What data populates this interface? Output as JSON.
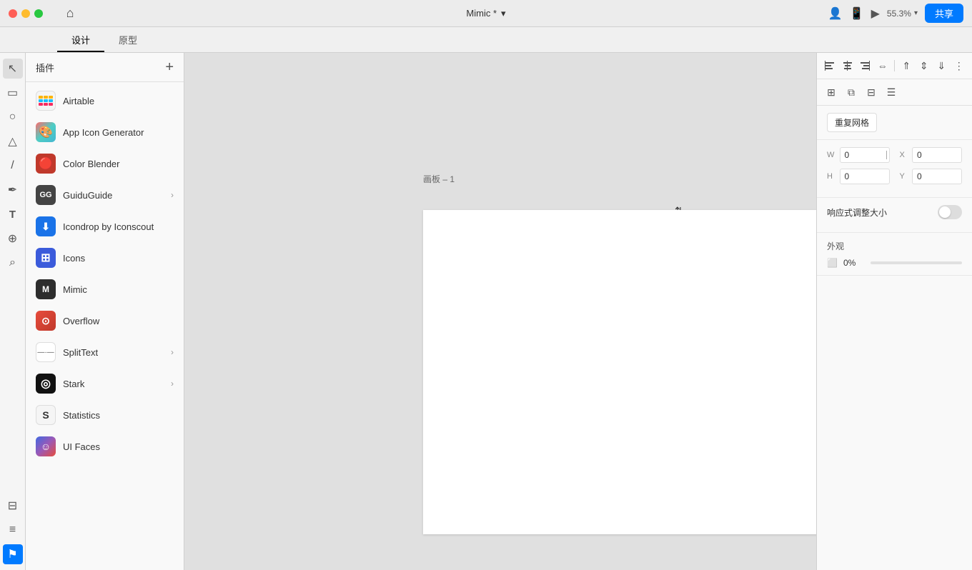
{
  "titlebar": {
    "app_name": "Mimic *",
    "dropdown_icon": "▾",
    "zoom_value": "55.3%",
    "share_label": "共享",
    "tabs": [
      {
        "label": "设计",
        "active": true
      },
      {
        "label": "原型",
        "active": false
      }
    ]
  },
  "left_tools": [
    {
      "name": "select-tool",
      "icon": "↖",
      "active": true
    },
    {
      "name": "frame-tool",
      "icon": "▭",
      "active": false
    },
    {
      "name": "shape-tool",
      "icon": "○",
      "active": false
    },
    {
      "name": "triangle-tool",
      "icon": "△",
      "active": false
    },
    {
      "name": "line-tool",
      "icon": "/",
      "active": false
    },
    {
      "name": "pen-tool",
      "icon": "✒",
      "active": false
    },
    {
      "name": "text-tool",
      "icon": "T",
      "active": false
    },
    {
      "name": "component-tool",
      "icon": "⊕",
      "active": false
    },
    {
      "name": "search-tool",
      "icon": "⌕",
      "active": false
    },
    {
      "name": "pages-tool",
      "icon": "⊟",
      "active": false
    },
    {
      "name": "layers-tool",
      "icon": "≡",
      "active": false
    },
    {
      "name": "assets-tool",
      "icon": "⚑",
      "active": false
    }
  ],
  "plugins_panel": {
    "title": "插件",
    "add_label": "+",
    "items": [
      {
        "name": "Airtable",
        "icon_type": "airtable",
        "icon_bg": "#f5f5f5",
        "has_chevron": false
      },
      {
        "name": "App Icon Generator",
        "icon_type": "color",
        "icon_bg": "#222",
        "icon_emoji": "🎨",
        "has_chevron": false
      },
      {
        "name": "Color Blender",
        "icon_type": "color",
        "icon_bg": "#e8453c",
        "icon_text": "🔴",
        "has_chevron": false
      },
      {
        "name": "GuiduGuide",
        "icon_type": "color",
        "icon_bg": "#4a4a4a",
        "icon_text": "GG",
        "has_chevron": true
      },
      {
        "name": "Icondrop by Iconscout",
        "icon_type": "color",
        "icon_bg": "#1a73e8",
        "icon_emoji": "⬇",
        "has_chevron": false
      },
      {
        "name": "Icons",
        "icon_type": "color",
        "icon_bg": "#4169e1",
        "icon_text": "⊞",
        "has_chevron": false
      },
      {
        "name": "Mimic",
        "icon_type": "color",
        "icon_bg": "#2d2d2d",
        "icon_text": "M",
        "has_chevron": false
      },
      {
        "name": "Overflow",
        "icon_type": "color",
        "icon_bg": "#c0392b",
        "icon_text": "⊙",
        "has_chevron": false
      },
      {
        "name": "SplitText",
        "icon_type": "color",
        "icon_bg": "#fff",
        "icon_text": "—",
        "has_chevron": true
      },
      {
        "name": "Stark",
        "icon_type": "color",
        "icon_bg": "#222",
        "icon_text": "◎",
        "has_chevron": true
      },
      {
        "name": "Statistics",
        "icon_type": "color",
        "icon_bg": "#f5f5f5",
        "icon_text": "S",
        "has_chevron": false
      },
      {
        "name": "UI Faces",
        "icon_type": "color",
        "icon_bg": "#4169e1",
        "icon_text": "☺",
        "has_chevron": false
      }
    ]
  },
  "canvas": {
    "artboard_label": "画板 – 1"
  },
  "right_panel": {
    "grid_button": "重复网格",
    "fields": {
      "w_label": "W",
      "w_value": "0",
      "h_label": "H",
      "h_value": "0",
      "x_label": "X",
      "x_value": "0",
      "y_label": "Y",
      "y_value": "0"
    },
    "responsive_label": "响应式调整大小",
    "appearance_label": "外观",
    "opacity_value": "0%"
  }
}
